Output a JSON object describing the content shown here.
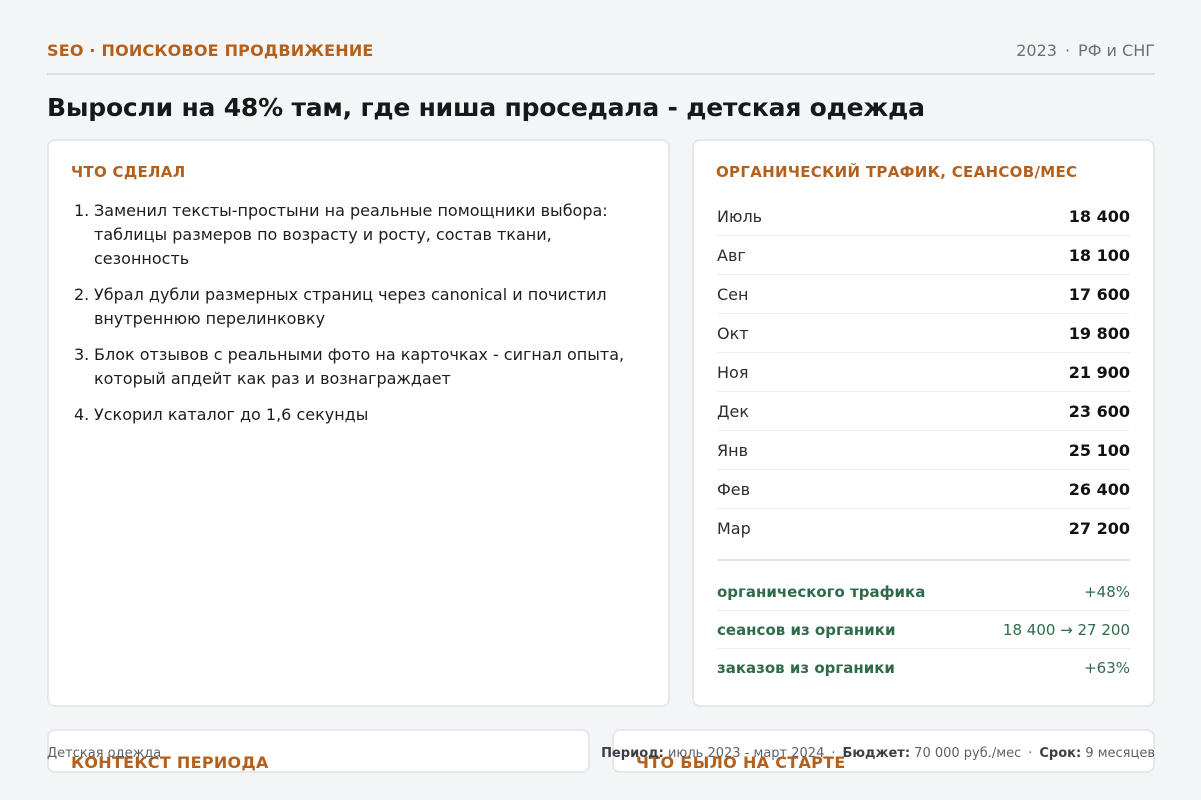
{
  "header": {
    "kicker": "SEO · ПОИСКОВОЕ ПРОДВИЖЕНИЕ",
    "year": "2023",
    "region": "РФ и СНГ"
  },
  "title": "Выросли на 48% там, где ниша проседала - детская одежда",
  "done": {
    "heading": "ЧТО СДЕЛАЛ",
    "items": [
      {
        "num": "1.",
        "text": "Заменил тексты-простыни на реальные помощники выбора: таблицы размеров по возрасту и росту, состав ткани, сезонность"
      },
      {
        "num": "2.",
        "text": "Убрал дубли размерных страниц через canonical и почистил внутреннюю перелинковку"
      },
      {
        "num": "3.",
        "text": "Блок отзывов с реальными фото на карточках - сигнал опыта, который апдейт как раз и вознаграждает"
      },
      {
        "num": "4.",
        "text": "Ускорил каталог до 1,6 секунды"
      }
    ]
  },
  "traffic": {
    "heading": "ОРГАНИЧЕСКИЙ ТРАФИК, СЕАНСОВ/МЕС",
    "rows": [
      {
        "month": "Июль",
        "value": "18 400"
      },
      {
        "month": "Авг",
        "value": "18 100"
      },
      {
        "month": "Сен",
        "value": "17 600"
      },
      {
        "month": "Окт",
        "value": "19 800"
      },
      {
        "month": "Ноя",
        "value": "21 900"
      },
      {
        "month": "Дек",
        "value": "23 600"
      },
      {
        "month": "Янв",
        "value": "25 100"
      },
      {
        "month": "Фев",
        "value": "26 400"
      },
      {
        "month": "Мар",
        "value": "27 200"
      }
    ],
    "summary": [
      {
        "label": "органического трафика",
        "value": "+48%"
      },
      {
        "label": "сеансов из органики",
        "value": "18 400 → 27 200"
      },
      {
        "label": "заказов из органики",
        "value": "+63%"
      }
    ]
  },
  "context": {
    "heading": "КОНТЕКСТ ПЕРИОДА"
  },
  "start": {
    "heading": "ЧТО БЫЛО НА СТАРТЕ"
  },
  "footer": {
    "niche": "Детская одежда",
    "period_label": "Период:",
    "period_value": "июль 2023 - март 2024",
    "budget_label": "Бюджет:",
    "budget_value": "70 000 руб./мес",
    "term_label": "Срок:",
    "term_value": "9 месяцев"
  },
  "colors": {
    "accent": "#b4601d",
    "positive": "#2f6b4a",
    "background": "#f4f5f7"
  }
}
